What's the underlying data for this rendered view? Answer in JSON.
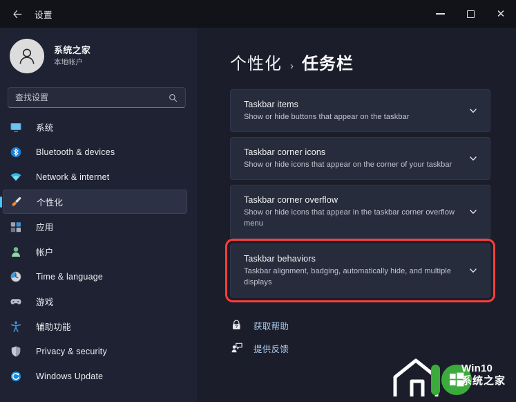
{
  "window": {
    "title": "设置",
    "back_icon": "back-arrow-icon",
    "minimize_label": "—",
    "maximize_label": "□",
    "close_label": "✕"
  },
  "account": {
    "name": "系统之家",
    "subtitle": "本地帐户",
    "avatar_icon": "person-avatar-icon"
  },
  "search": {
    "placeholder": "查找设置",
    "value": "",
    "icon": "search-icon"
  },
  "sidebar": {
    "items": [
      {
        "label": "系统",
        "icon": "monitor-icon",
        "selected": false
      },
      {
        "label": "Bluetooth & devices",
        "icon": "bluetooth-icon",
        "selected": false
      },
      {
        "label": "Network & internet",
        "icon": "wifi-icon",
        "selected": false
      },
      {
        "label": "个性化",
        "icon": "paintbrush-icon",
        "selected": true
      },
      {
        "label": "应用",
        "icon": "apps-icon",
        "selected": false
      },
      {
        "label": "帐户",
        "icon": "account-icon",
        "selected": false
      },
      {
        "label": "Time & language",
        "icon": "clock-icon",
        "selected": false
      },
      {
        "label": "游戏",
        "icon": "gamepad-icon",
        "selected": false
      },
      {
        "label": "辅助功能",
        "icon": "accessibility-icon",
        "selected": false
      },
      {
        "label": "Privacy & security",
        "icon": "shield-icon",
        "selected": false
      },
      {
        "label": "Windows Update",
        "icon": "update-icon",
        "selected": false
      }
    ]
  },
  "main": {
    "breadcrumb": {
      "parent": "个性化",
      "separator": "›",
      "current": "任务栏"
    },
    "cards": [
      {
        "title": "Taskbar items",
        "subtitle": "Show or hide buttons that appear on the taskbar",
        "chevron": "chevron-down-icon",
        "highlighted": false
      },
      {
        "title": "Taskbar corner icons",
        "subtitle": "Show or hide icons that appear on the corner of your taskbar",
        "chevron": "chevron-down-icon",
        "highlighted": false
      },
      {
        "title": "Taskbar corner overflow",
        "subtitle": "Show or hide icons that appear in the taskbar corner overflow menu",
        "chevron": "chevron-down-icon",
        "highlighted": false
      },
      {
        "title": "Taskbar behaviors",
        "subtitle": "Taskbar alignment, badging, automatically hide, and multiple displays",
        "chevron": "chevron-down-icon",
        "highlighted": true
      }
    ],
    "links": [
      {
        "label": "获取帮助",
        "icon": "get-help-icon"
      },
      {
        "label": "提供反馈",
        "icon": "feedback-icon"
      }
    ]
  },
  "watermark": {
    "line1": "Win10",
    "line2": "系统之家",
    "logo_icon": "win10-house-logo-icon"
  },
  "colors": {
    "accent": "#4cc2ff",
    "highlight_border": "#fc3d39",
    "page_bg": "#1b1e2a",
    "sidebar_bg": "#1e2232",
    "card_bg": "#272c3c",
    "link_text": "#a9c8ec",
    "watermark_green": "#3cab3c"
  }
}
